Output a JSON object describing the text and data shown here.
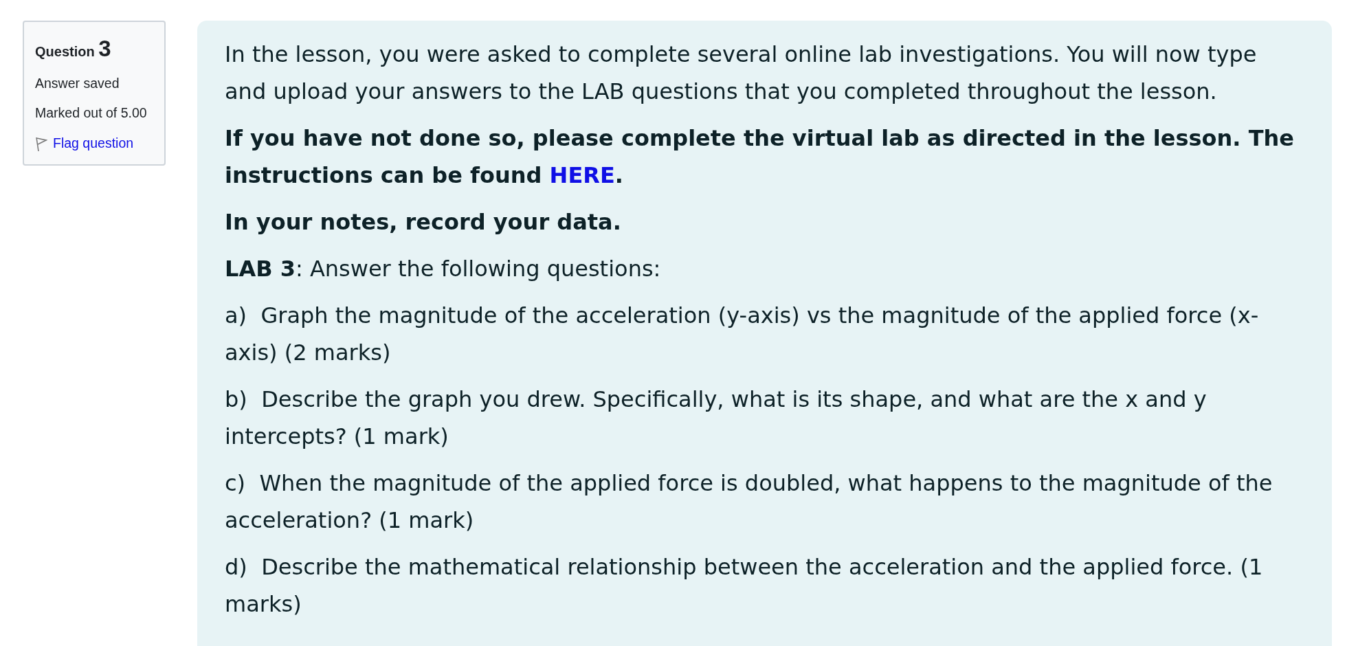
{
  "question_info": {
    "label": "Question",
    "number": "3",
    "state": "Answer saved",
    "grade": "Marked out of 5.00",
    "flag_link": "Flag question"
  },
  "content": {
    "intro": "In the lesson, you were asked to complete several online lab investigations. You will now type and upload your answers to the LAB questions that you completed throughout the lesson.",
    "instruction": {
      "before": "If you have not done so, please complete the virtual lab as directed in the lesson.  The instructions can be found ",
      "link": "HERE",
      "after": "."
    },
    "notes": "In your notes, record your data.",
    "lab_heading": "**LAB 3**:  Answer the following questions:",
    "questions": [
      {
        "label": "a)",
        "text": "Graph the magnitude of the acceleration (y-axis) vs the magnitude of the applied force (x-axis) (2 marks)"
      },
      {
        "label": "b)",
        "text": "Describe the graph you drew.  Specifically, what is its shape, and what are the x and y intercepts? (1 mark)"
      },
      {
        "label": "c)",
        "text": "When the magnitude of the applied force is doubled, what happens to the magnitude of the acceleration? (1 mark)"
      },
      {
        "label": "d)",
        "text": "Describe the mathematical relationship between the acceleration and the applied force. (1 marks)"
      }
    ]
  }
}
